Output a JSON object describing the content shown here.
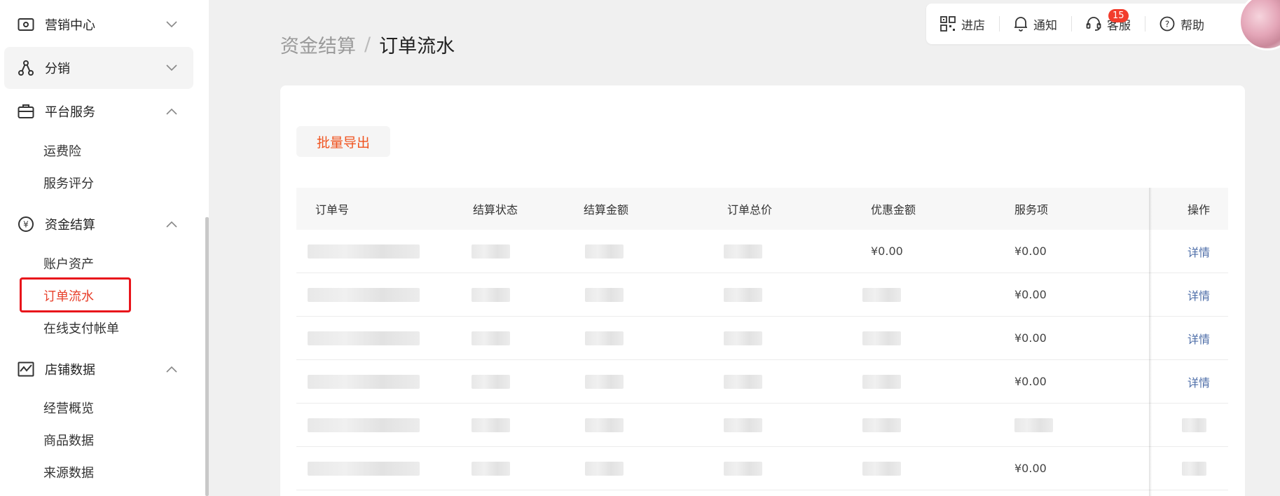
{
  "sidebar": {
    "groups": [
      {
        "label": "营销中心",
        "icon": "coupon-icon",
        "expanded": false
      },
      {
        "label": "分销",
        "icon": "share-network-icon",
        "expanded": false,
        "active": true
      },
      {
        "label": "平台服务",
        "icon": "briefcase-icon",
        "expanded": true
      },
      {
        "label": "资金结算",
        "icon": "yen-circle-icon",
        "expanded": true
      },
      {
        "label": "店铺数据",
        "icon": "chart-line-icon",
        "expanded": true
      }
    ],
    "platform_items": [
      "运费险",
      "服务评分"
    ],
    "finance_items": [
      "账户资产",
      "订单流水",
      "在线支付帐单"
    ],
    "data_items": [
      "经营概览",
      "商品数据",
      "来源数据"
    ],
    "current_item": "订单流水"
  },
  "breadcrumb": {
    "parent": "资金结算",
    "separator": "/",
    "current": "订单流水"
  },
  "topbar": {
    "shop": "进店",
    "notify": "通知",
    "service": "客服",
    "service_badge": "15",
    "help": "帮助"
  },
  "toolbar": {
    "export_label": "批量导出"
  },
  "table": {
    "columns": [
      "订单号",
      "结算状态",
      "结算金额",
      "订单总价",
      "优惠金额",
      "服务项",
      "操作"
    ],
    "rows": [
      {
        "discount": "¥0.00",
        "service": "¥0.00",
        "action": "详情"
      },
      {
        "discount": "",
        "service": "¥0.00",
        "action": "详情"
      },
      {
        "discount": "",
        "service": "¥0.00",
        "action": "详情"
      },
      {
        "discount": "",
        "service": "¥0.00",
        "action": "详情"
      },
      {
        "discount": "",
        "service": "",
        "action": ""
      },
      {
        "discount": "",
        "service": "¥0.00",
        "action": ""
      }
    ]
  },
  "colors": {
    "accent": "#e8412c",
    "highlight_box": "#e8141b",
    "link": "#4e6ea8",
    "badge": "#f23c2c"
  }
}
